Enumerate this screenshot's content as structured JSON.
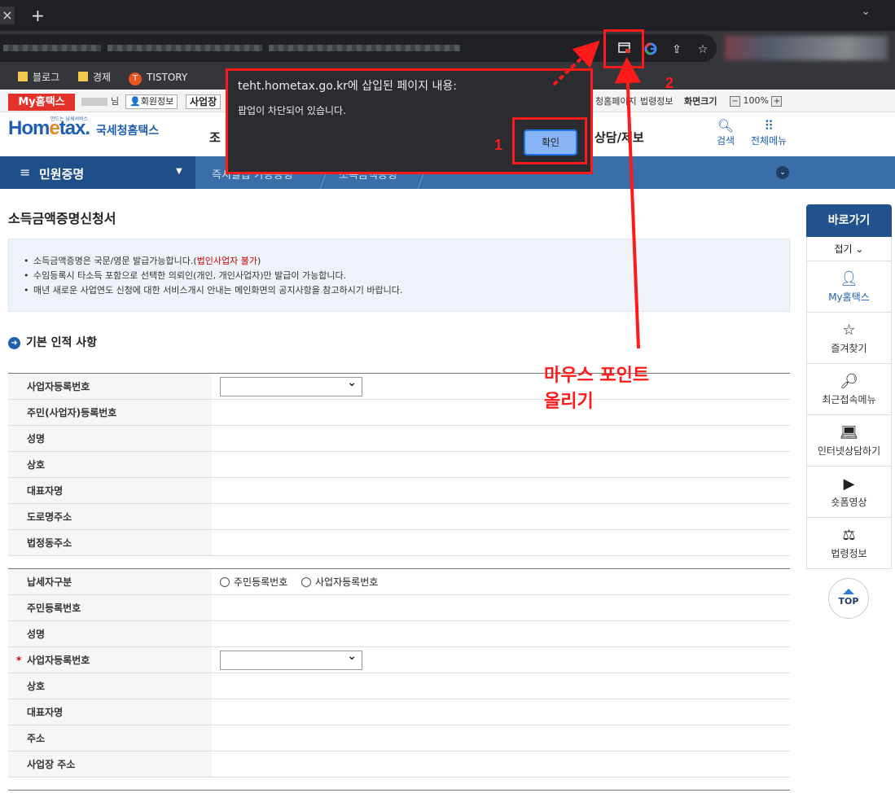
{
  "browser": {
    "new_tab": "+",
    "close_tab": "×",
    "bookmarks": [
      {
        "label": "블로그",
        "icon": "folder-icon"
      },
      {
        "label": "경제",
        "icon": "folder-icon"
      },
      {
        "label": "TISTORY",
        "icon": "tistory-icon"
      }
    ]
  },
  "utility": {
    "my_badge": "My홈택스",
    "user_suffix": "님",
    "member_info": "회원정보",
    "business": "사업장",
    "right_links": [
      "청홈페이지",
      "법령정보",
      "화면크기"
    ],
    "zoom": "100%"
  },
  "header": {
    "logo_main_a": "Hom",
    "logo_main_e": "e",
    "logo_main_b": "tax.",
    "logo_sub": "국세청홈택스",
    "logo_tag": "만드는 납세서비스",
    "gnb_left": "조",
    "gnb_right": "상담/제보",
    "search": "검색",
    "all_menu": "전체메뉴"
  },
  "nav": {
    "section": "민원증명",
    "crumbs": [
      "즉시발급 가능증명",
      "소득금액증명"
    ]
  },
  "page": {
    "title": "소득금액증명신청서",
    "notice": {
      "line1_a": "소득금액증명은 국문/영문 발급가능합니다.(",
      "line1_red": "법인사업자 불가",
      "line1_b": ")",
      "line2": "수임등록시 타소득 포함으로 선택한 의뢰인(개인, 개인사업자)만 발급이 가능합니다.",
      "line3": "매년 새로운 사업연도 신청에 대한 서비스개시 안내는 메인화면의 공지사항을 참고하시기 바랍니다."
    },
    "section_title": "기본 인적 사항",
    "table1": [
      "사업자등록번호",
      "주민(사업자)등록번호",
      "성명",
      "상호",
      "대표자명",
      "도로명주소",
      "법정동주소"
    ],
    "table2": [
      "납세자구분",
      "주민등록번호",
      "성명",
      "사업자등록번호",
      "상호",
      "대표자명",
      "주소",
      "사업장 주소"
    ],
    "radio_options": [
      "주민등록번호",
      "사업자등록번호"
    ],
    "required_mark": "*"
  },
  "quick": {
    "title": "바로가기",
    "fold": "접기 ⌄",
    "items": [
      "My홈택스",
      "즐겨찾기",
      "최근접속메뉴",
      "인터넷상담하기",
      "숏폼영상",
      "법령정보"
    ],
    "top": "TOP"
  },
  "dialog": {
    "title": "teht.hometax.go.kr에 삽입된 페이지 내용:",
    "message": "팝업이 차단되어 있습니다.",
    "ok": "확인"
  },
  "annotations": {
    "num1": "1",
    "num2": "2",
    "text_line1": "마우스 포인트",
    "text_line2": "올리기",
    "color": "#ff1a1a"
  }
}
